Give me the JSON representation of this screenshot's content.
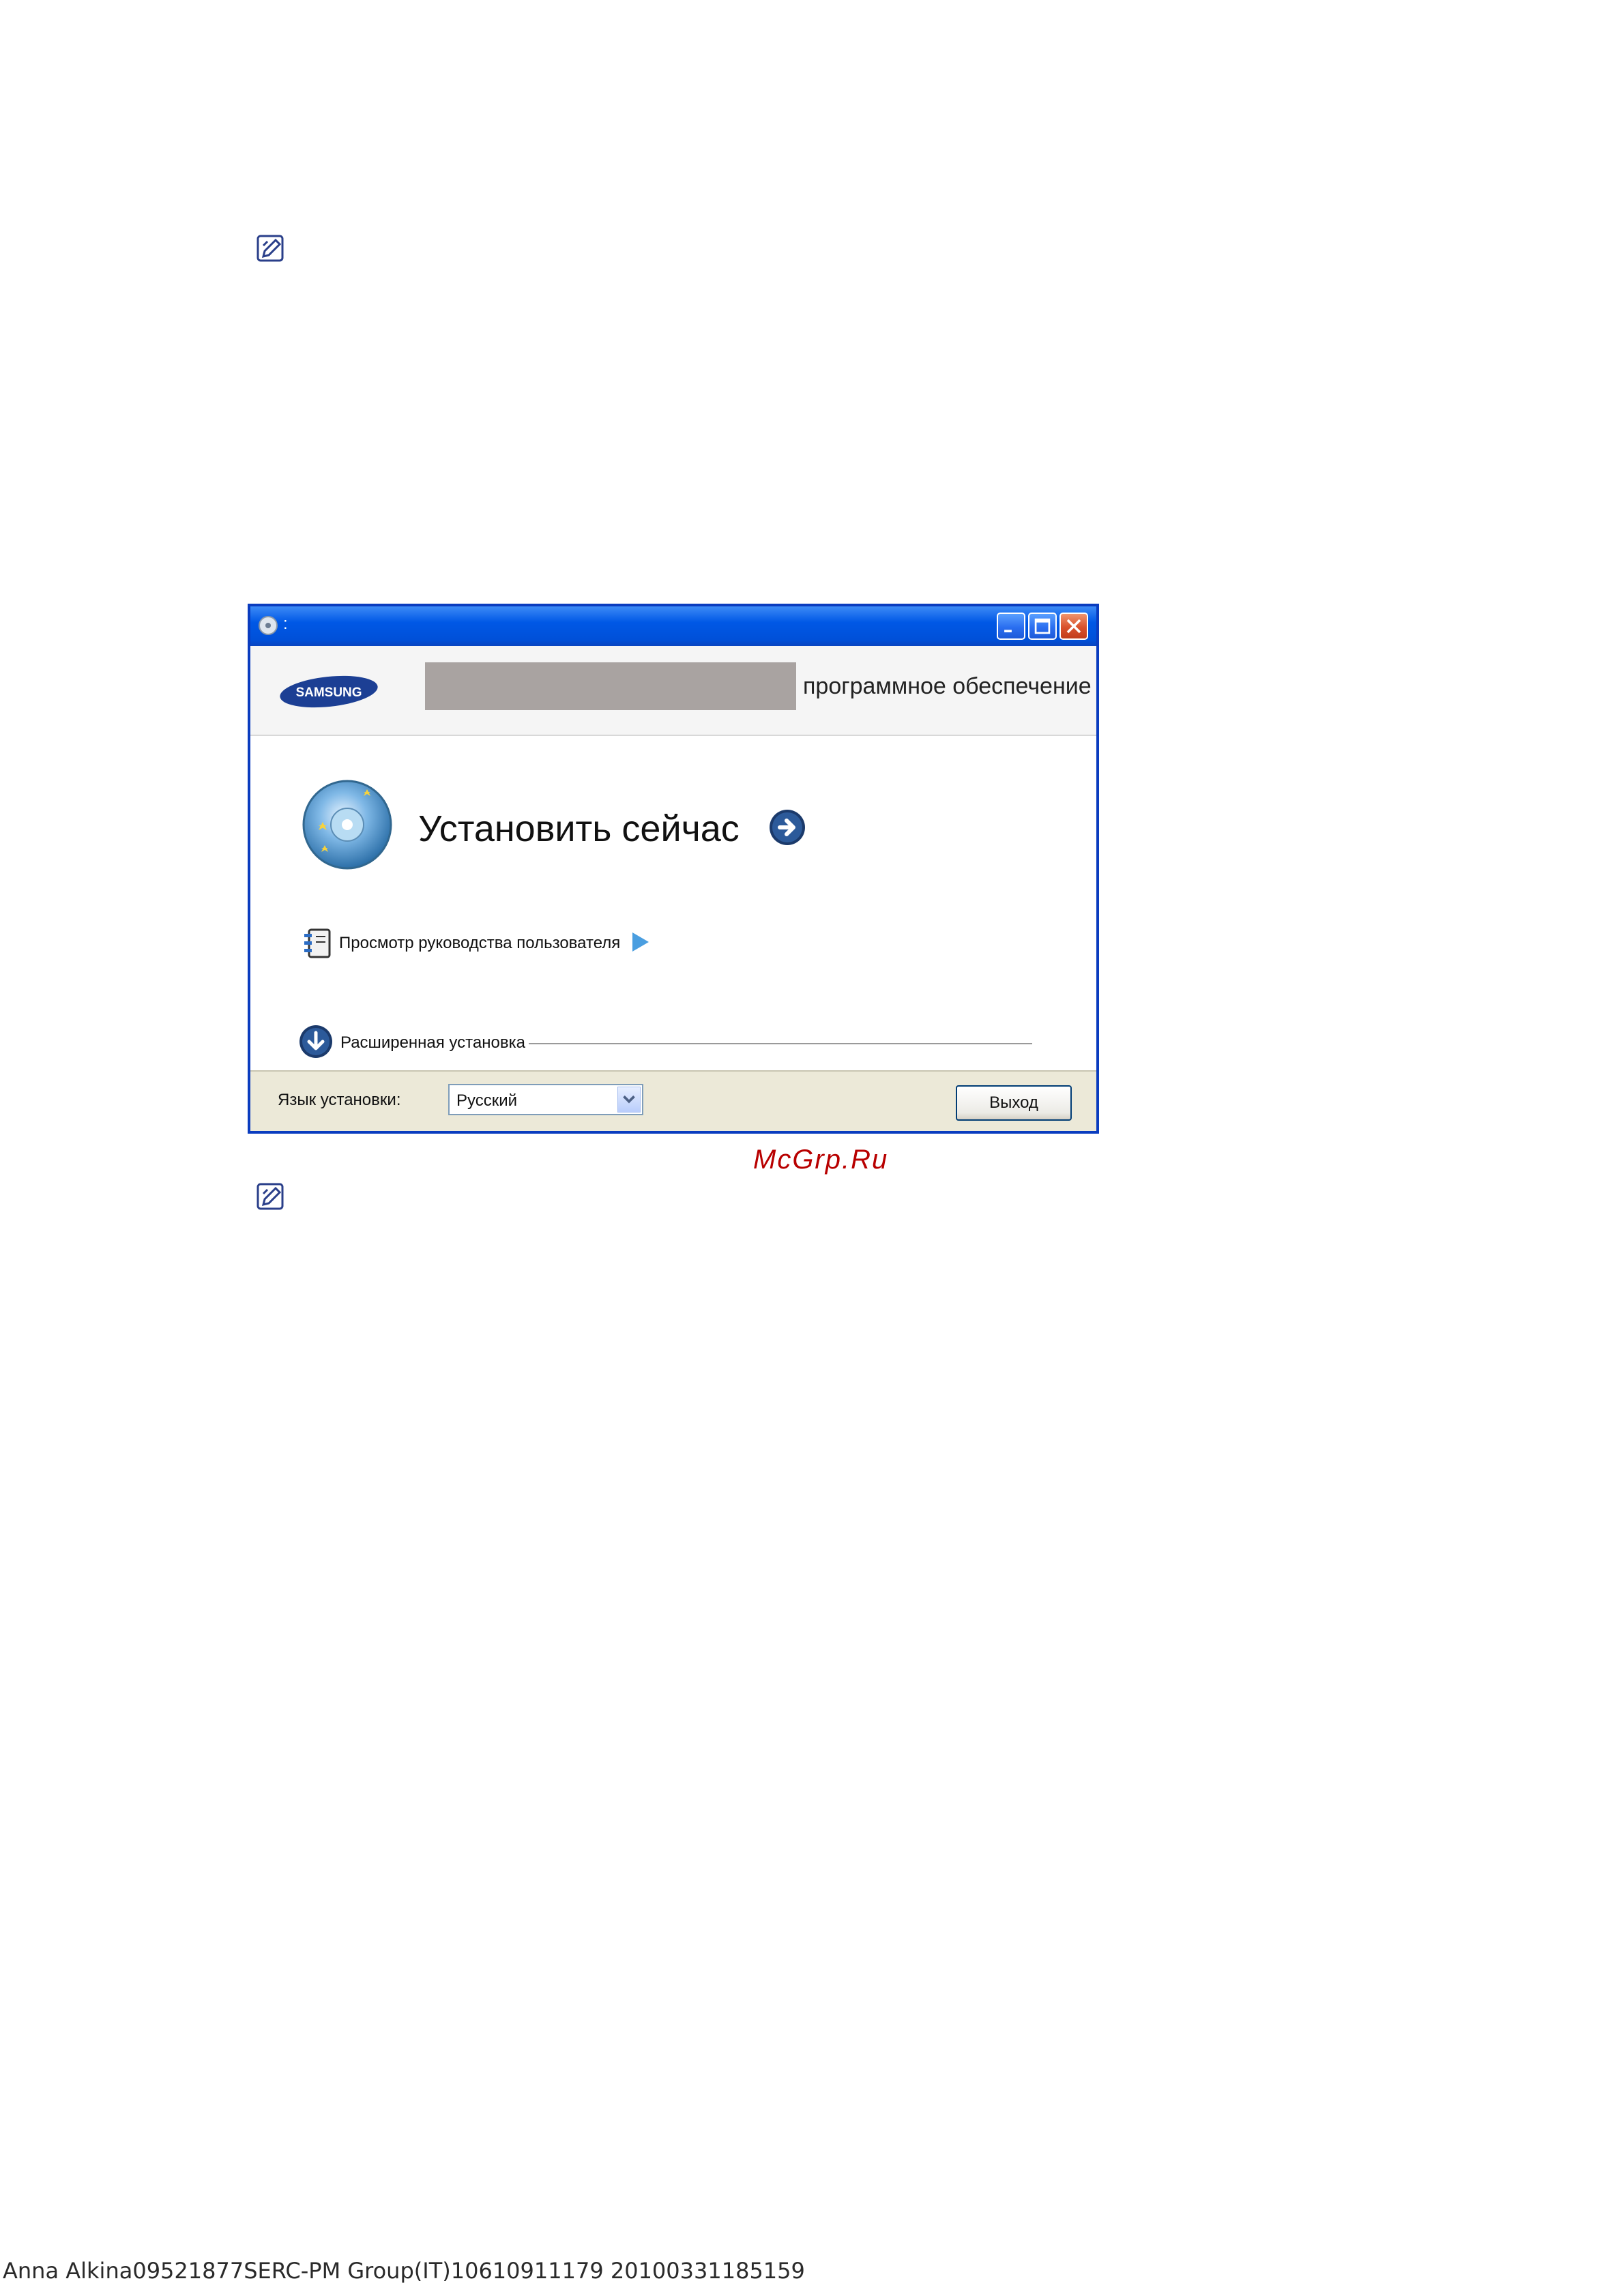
{
  "installer": {
    "header_caption": "программное обеспечение",
    "brand": "SAMSUNG",
    "install_now": "Установить сейчас",
    "view_manual": "Просмотр руководства пользователя",
    "advanced_install": "Расширенная установка",
    "language_label": "Язык установки:",
    "language_value": "Русский",
    "exit_label": "Выход"
  },
  "watermark": "McGrp.Ru",
  "footer_text": "Anna Alkina09521877SERC-PM Group(IT)10610911179 20100331185159",
  "icons": [
    "note-icon",
    "cd-icon",
    "samsung-logo",
    "install-arrow-icon",
    "manual-book-icon",
    "play-arrow-icon",
    "download-arrow-icon",
    "minimize-icon",
    "maximize-icon",
    "close-icon",
    "chevron-down-icon"
  ],
  "colors": {
    "titlebar": "#0058e6",
    "window_border": "#0a3cbf",
    "footer_bg": "#ece9d8",
    "watermark": "#b80000",
    "samsung_blue": "#1c3f94"
  }
}
